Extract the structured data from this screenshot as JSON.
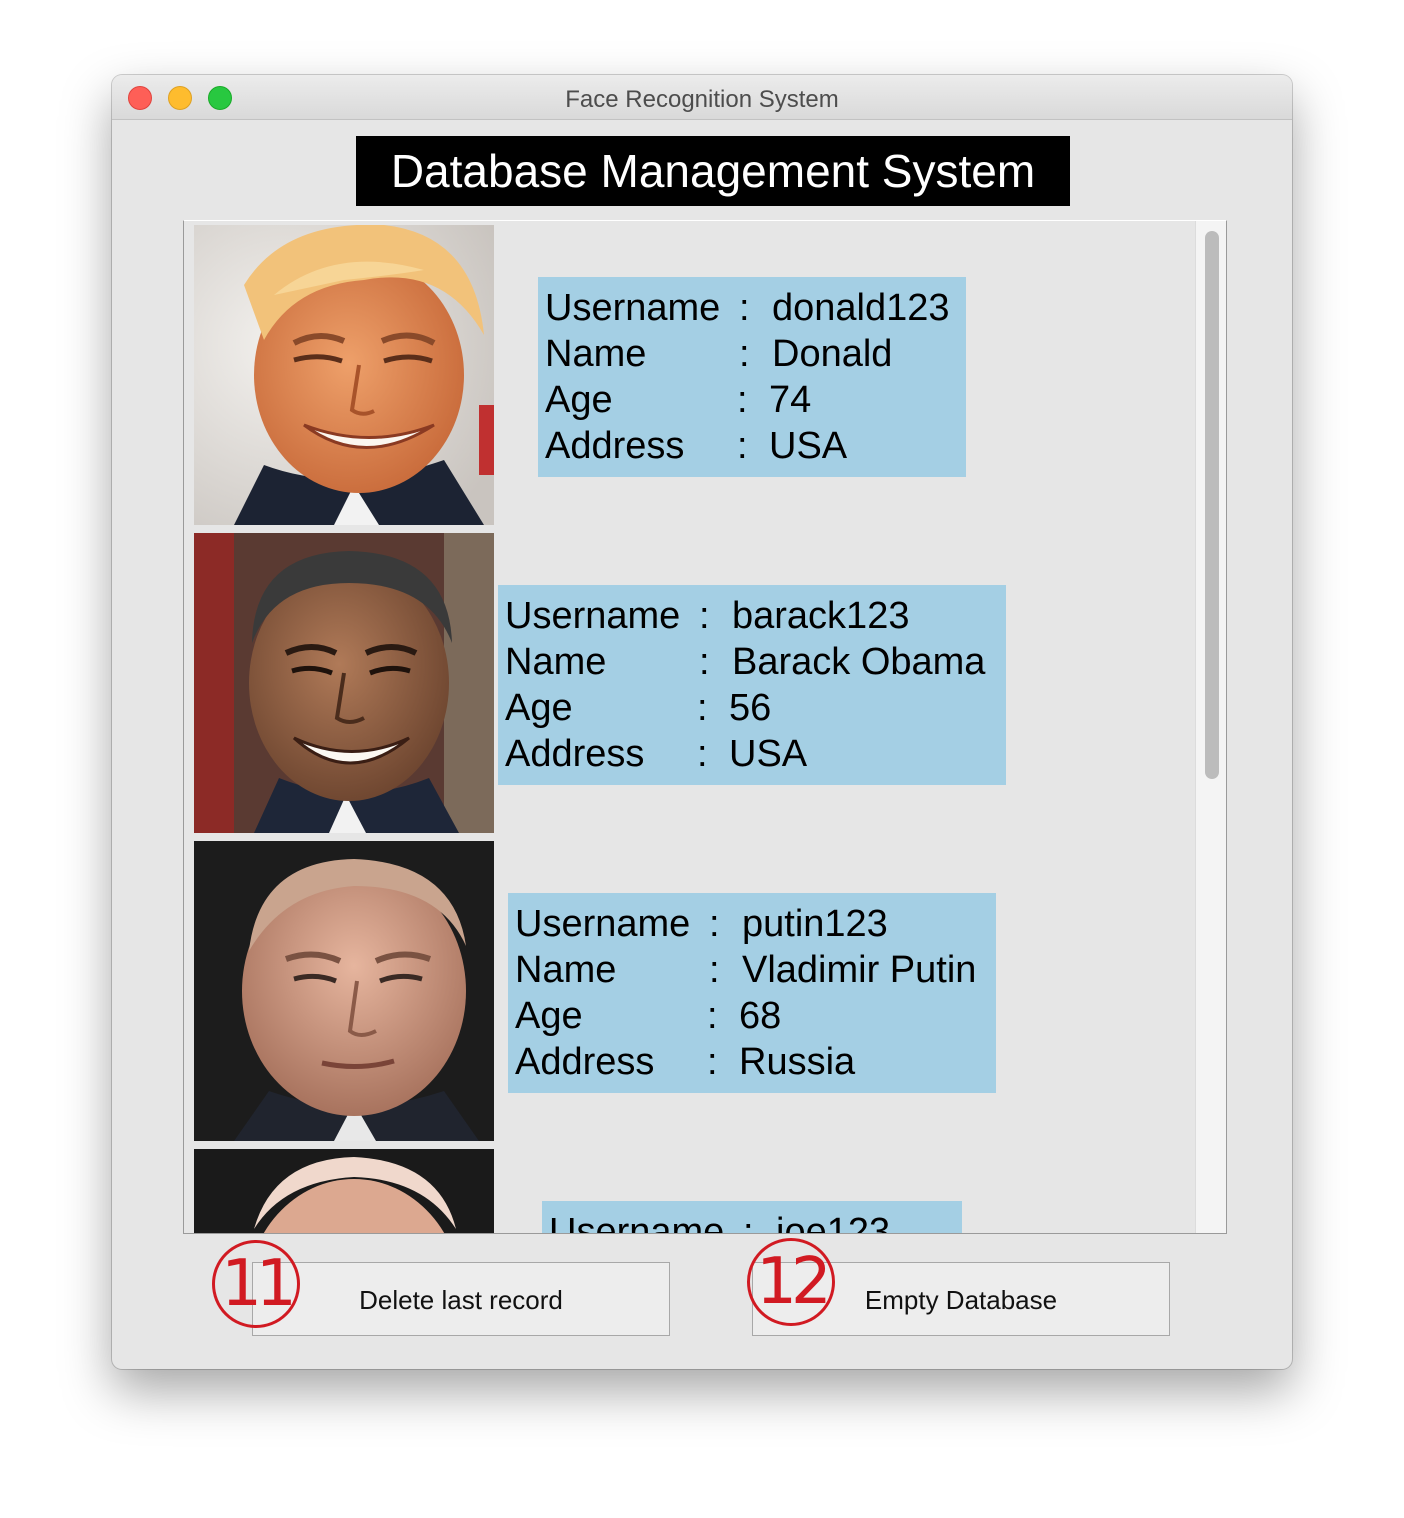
{
  "window": {
    "title": "Face Recognition System"
  },
  "heading": "Database Management System",
  "labels": {
    "username": "Username",
    "name": "Name",
    "age": "Age",
    "address": "Address",
    "sep": ":"
  },
  "records": [
    {
      "username": "donald123",
      "name": "Donald",
      "age": "74",
      "address": "USA"
    },
    {
      "username": "barack123",
      "name": "Barack Obama",
      "age": "56",
      "address": "USA"
    },
    {
      "username": "putin123",
      "name": "Vladimir Putin",
      "age": "68",
      "address": "Russia"
    },
    {
      "username": "joe123"
    }
  ],
  "buttons": {
    "delete_last": "Delete last record",
    "empty_db": "Empty Database"
  },
  "annotations": {
    "badge_delete": "11",
    "badge_empty": "12"
  },
  "colors": {
    "info_bg": "#a4cfe4",
    "heading_bg": "#000000",
    "badge": "#d11a22"
  }
}
